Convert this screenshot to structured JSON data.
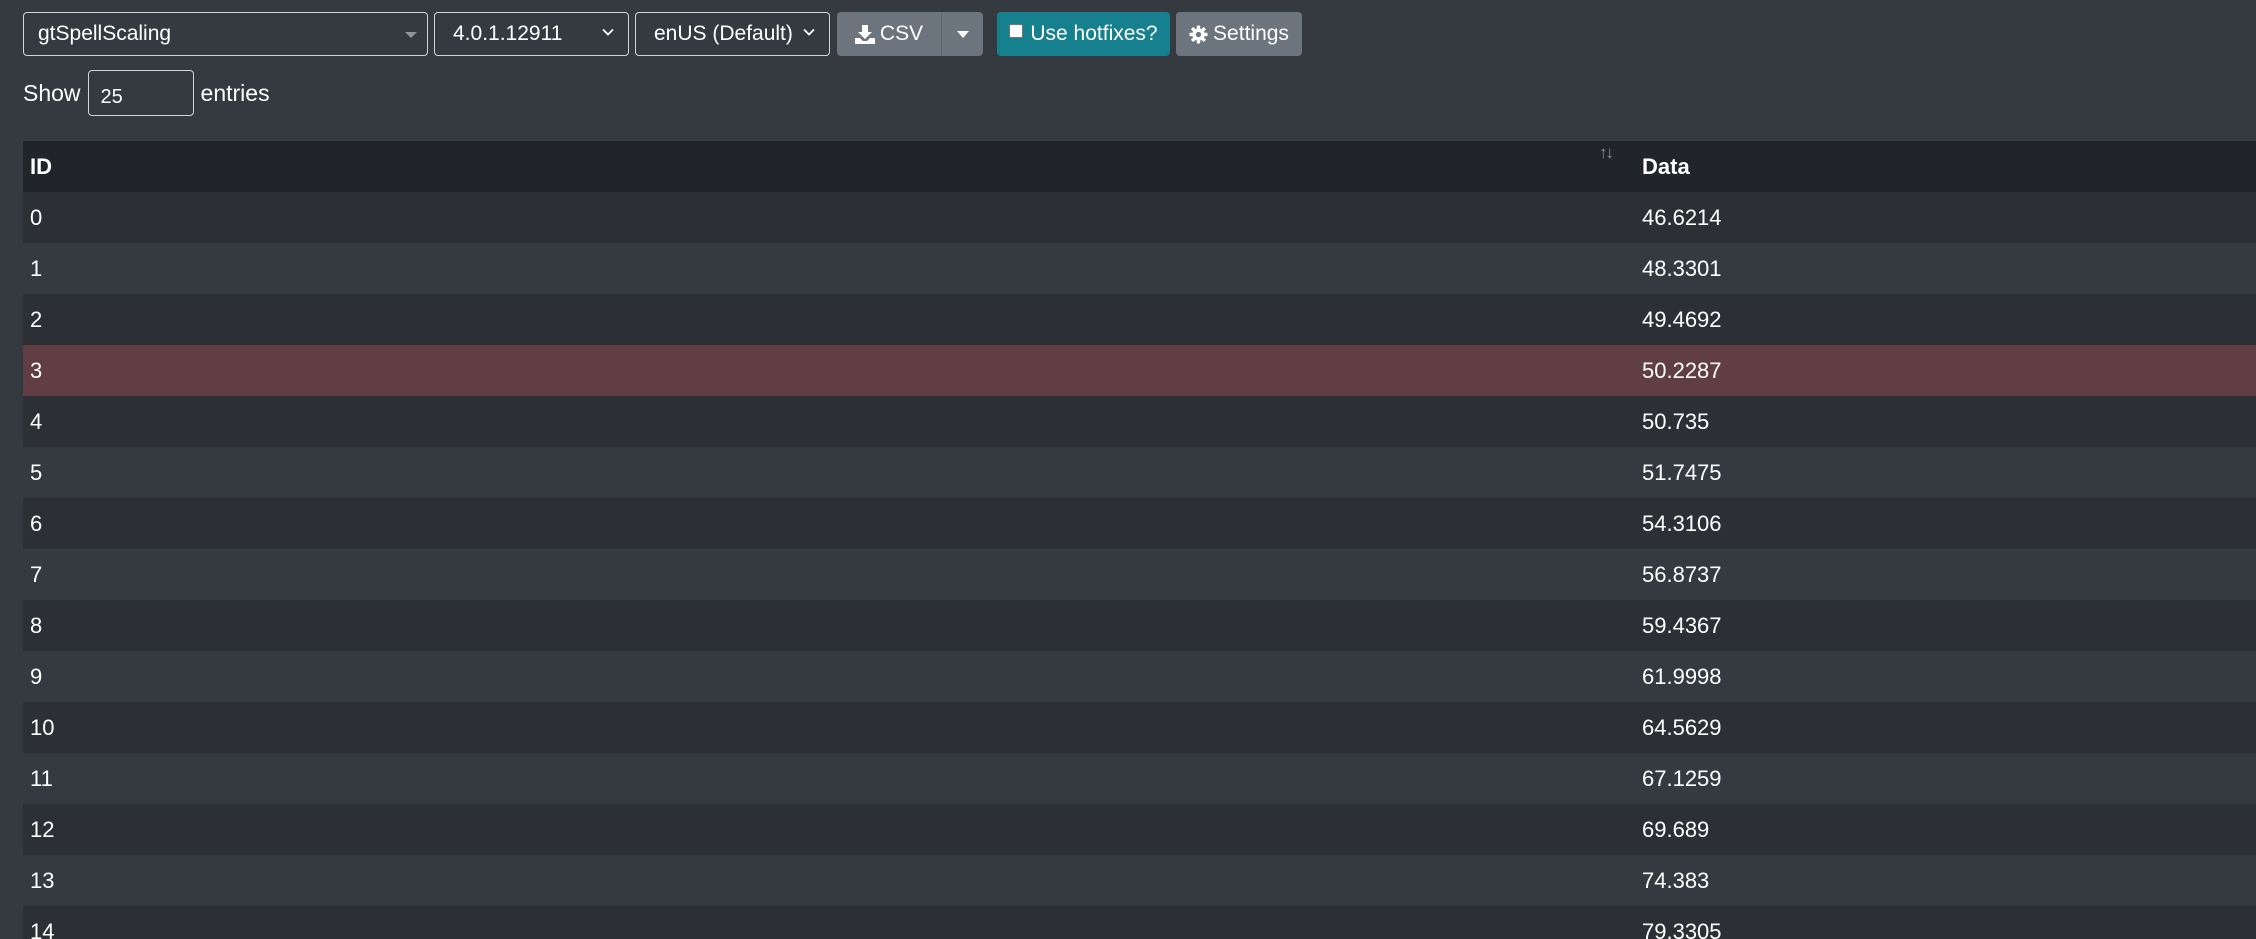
{
  "toolbar": {
    "table_select": "gtSpellScaling",
    "build_select": "4.0.1.12911",
    "locale_select": "enUS (Default)",
    "csv_label": "CSV",
    "hotfix_label": "Use hotfixes?",
    "settings_label": "Settings"
  },
  "entries": {
    "show_label": "Show",
    "value": "25",
    "suffix_label": "entries"
  },
  "table": {
    "columns": [
      "ID",
      "Data"
    ],
    "rows": [
      {
        "id": "0",
        "data": "46.6214"
      },
      {
        "id": "1",
        "data": "48.3301"
      },
      {
        "id": "2",
        "data": "49.4692"
      },
      {
        "id": "3",
        "data": "50.2287"
      },
      {
        "id": "4",
        "data": "50.735"
      },
      {
        "id": "5",
        "data": "51.7475"
      },
      {
        "id": "6",
        "data": "54.3106"
      },
      {
        "id": "7",
        "data": "56.8737"
      },
      {
        "id": "8",
        "data": "59.4367"
      },
      {
        "id": "9",
        "data": "61.9998"
      },
      {
        "id": "10",
        "data": "64.5629"
      },
      {
        "id": "11",
        "data": "67.1259"
      },
      {
        "id": "12",
        "data": "69.689"
      },
      {
        "id": "13",
        "data": "74.383"
      },
      {
        "id": "14",
        "data": "79.3305"
      }
    ],
    "selected_row_id": "3"
  },
  "colors": {
    "background": "#343a40",
    "header": "#212529",
    "selected_row": "#613e44",
    "hotfix_button": "#17808f",
    "secondary_button": "#6c757d"
  }
}
